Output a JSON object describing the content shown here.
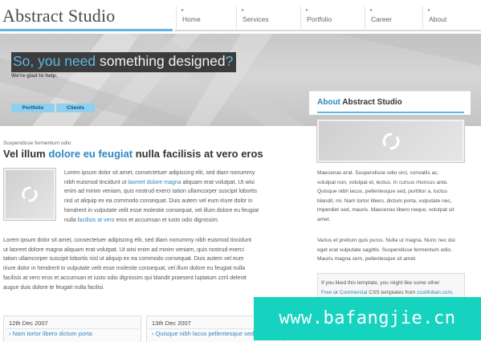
{
  "header": {
    "logo": "Abstract Studio",
    "nav": [
      {
        "label": "Home"
      },
      {
        "label": "Services"
      },
      {
        "label": "Portfolio"
      },
      {
        "label": "Career"
      },
      {
        "label": "About"
      }
    ]
  },
  "banner": {
    "headline_blue_1": "So, you need",
    "headline_white": " something designed",
    "headline_blue_2": "?",
    "tagline": "We're glad to help.",
    "buttons": [
      {
        "label": "Portfolio"
      },
      {
        "label": "Clients"
      }
    ]
  },
  "main": {
    "kicker": "Suspendisse fermentum odio",
    "heading_1": "Vel illum ",
    "heading_blue": "dolore eu feugiat",
    "heading_2": " nulla facilisis at vero eros",
    "para1_lines": [
      "Lorem ipsum dolor sit amet, consectetuer adipiscing elit, sed diam nonummy",
      "nibh euismod tincidunt ut ",
      "aliquam erat volutpat. Ut wisi",
      "enim ad minim veniam, quis nostrud exerci tation ullamcorper suscipit lobortis",
      "nisl ut aliquip ex ea commodo consequat. Duis autem vel eum iriure dolor in",
      "hendrerit in vulputate velit esse molestie consequat, vel illum dolore eu feugiat",
      "nulla ",
      " eros et accumsan et iusto odio dignissim."
    ],
    "para1_link1": "laoreet dolore magna",
    "para1_link2": "facilisis at vero",
    "para2_lines": [
      "Lorem ipsum dolor sit amet, consectetuer adipiscing elit, sed diam nonummy nibh euismod tincidunt",
      "ut laoreet dolore magna aliquam erat volutpat. Ut wisi enim ad minim veniam, quis nostrud exerci",
      "tation ullamcorper suscipit lobortis nisl ut aliquip ex ea commodo consequat. Duis autem vel eum",
      "iriure dolor in hendrerit in vulputate velit esse molestie consequat, vel illum dolore eu feugiat nulla",
      "facilisis at vero eros et accumsan et iusto odio dignissim qui blandit praesent luptatum zzril delenit",
      "augue duis dolore te feugait nulla facilisi."
    ],
    "news": [
      {
        "date": "12th Dec 2007",
        "link": "Nam tortor libero dictum porta"
      },
      {
        "date": "13th Dec 2007",
        "link": "Quisque nibh lacus pellentesque sed"
      }
    ]
  },
  "sidebar": {
    "title_blue": "About",
    "title_dark": " Abstract Studio",
    "para1_lines": [
      "Maecenas erat. Suspendisse odio orci, convallis ac,",
      "volutpat non, volutpat et, lectus. In cursus rhoncus ante.",
      "Quisque nibh lacus, pellentesque sed, porttitor a, luctus",
      "blandit, mi. Nam tortor libero, dictum porta, vulputate nec,",
      "imperdiet sed, mauris. Maecenas libero neque, volutpat sit",
      "amet."
    ],
    "para2_lines": [
      "Varius et pretium quis purus. Nulla ut magna. Nunc nec dui",
      "eget erat vulputate sagittis. Suspendisse fermentum odio.",
      "Mauris magna sem, pellentesque sit amet."
    ],
    "box_line1": "If you liked this template, you might like some other",
    "box_free": "Free",
    "box_or": " or ",
    "box_commercial": "Commercial",
    "box_mid": " CSS templates from ",
    "box_site": "cssMoban.com",
    "box_end": "."
  },
  "watermark": "www.bafangjie.cn",
  "colors": {
    "accent": "#5fb7e6",
    "link": "#2f86c3",
    "button": "#8fd0f0",
    "watermark": "#16d3c0"
  }
}
